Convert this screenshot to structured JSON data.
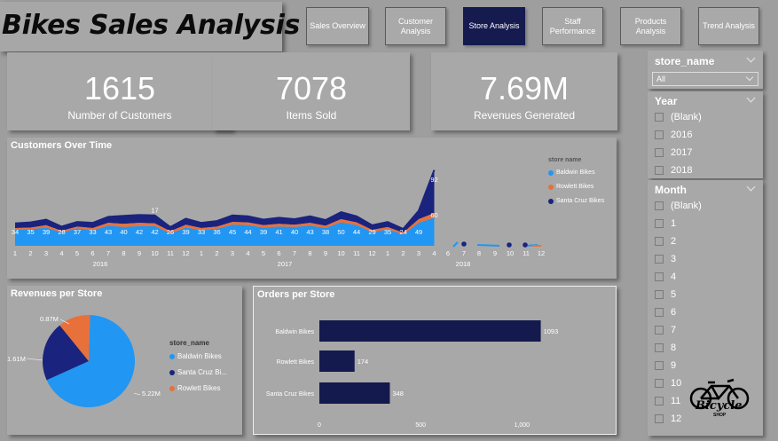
{
  "app": {
    "title": "Bikes Sales Analysis"
  },
  "nav": [
    {
      "label": "Sales Overview",
      "active": false
    },
    {
      "label": "Customer Analysis",
      "active": false
    },
    {
      "label": "Store Analysis",
      "active": true
    },
    {
      "label": "Staff Performance",
      "active": false
    },
    {
      "label": "Products Analysis",
      "active": false
    },
    {
      "label": "Trend Analysis",
      "active": false
    }
  ],
  "kpis": [
    {
      "value": "1615",
      "label": "Number of Customers"
    },
    {
      "value": "7078",
      "label": "Items Sold"
    },
    {
      "value": "7.69M",
      "label": "Revenues Generated"
    }
  ],
  "customers_chart": {
    "title": "Customers Over Time",
    "legend_title": "store name",
    "legend": [
      "Baldwin Bikes",
      "Rowlett Bikes",
      "Santa Cruz Bikes"
    ],
    "colors": [
      "#2196f3",
      "#e8703a",
      "#1a237e"
    ],
    "month_ticks": [
      "1",
      "2",
      "3",
      "4",
      "5",
      "6",
      "7",
      "8",
      "9",
      "10",
      "11",
      "12",
      "1",
      "2",
      "3",
      "4",
      "5",
      "6",
      "7",
      "8",
      "9",
      "10",
      "11",
      "12",
      "1",
      "2",
      "3",
      "4",
      "6",
      "7",
      "8",
      "9",
      "10",
      "11",
      "12"
    ],
    "year_ticks": [
      "2016",
      "2017",
      "2018"
    ]
  },
  "revenue_pie": {
    "title": "Revenues per Store",
    "legend_title": "store_name",
    "legend": [
      "Baldwin Bikes",
      "Santa Cruz Bi...",
      "Rowlett Bikes"
    ],
    "slice_labels": [
      "5.22M",
      "1.61M",
      "0.87M"
    ]
  },
  "orders_bar": {
    "title": "Orders per Store",
    "categories": [
      "Baldwin Bikes",
      "Rowlett Bikes",
      "Santa Cruz Bikes"
    ],
    "value_labels": [
      "1093",
      "174",
      "348"
    ],
    "axis_ticks": [
      "0",
      "500",
      "1,000"
    ]
  },
  "slicers": {
    "store": {
      "header": "store_name",
      "value": "All"
    },
    "year": {
      "header": "Year",
      "options": [
        "(Blank)",
        "2016",
        "2017",
        "2018"
      ]
    },
    "month": {
      "header": "Month",
      "options": [
        "(Blank)",
        "1",
        "2",
        "3",
        "4",
        "5",
        "6",
        "7",
        "8",
        "9",
        "10",
        "11",
        "12"
      ]
    }
  },
  "logo": {
    "text": "Bicycle",
    "subtext": "SHOP"
  },
  "chart_data": [
    {
      "type": "area",
      "title": "Customers Over Time",
      "xlabel": "",
      "ylabel": "",
      "x": [
        "2016-01",
        "2016-02",
        "2016-03",
        "2016-04",
        "2016-05",
        "2016-06",
        "2016-07",
        "2016-08",
        "2016-09",
        "2016-10",
        "2016-11",
        "2016-12",
        "2017-01",
        "2017-02",
        "2017-03",
        "2017-04",
        "2017-05",
        "2017-06",
        "2017-07",
        "2017-08",
        "2017-09",
        "2017-10",
        "2017-11",
        "2017-12",
        "2018-01",
        "2018-02",
        "2018-03",
        "2018-04"
      ],
      "series": [
        {
          "name": "Baldwin Bikes",
          "values": [
            34,
            35,
            39,
            28,
            37,
            33,
            43,
            40,
            42,
            42,
            26,
            39,
            33,
            36,
            45,
            44,
            39,
            41,
            40,
            43,
            38,
            50,
            44,
            29,
            35,
            24,
            49,
            60
          ]
        },
        {
          "name": "Rowlett Bikes",
          "values": [
            4,
            4,
            5,
            4,
            4,
            5,
            6,
            7,
            7,
            6,
            5,
            6,
            5,
            5,
            6,
            6,
            5,
            6,
            5,
            6,
            5,
            7,
            6,
            5,
            5,
            4,
            8,
            10
          ]
        },
        {
          "name": "Santa Cruz Bikes",
          "values": [
            10,
            11,
            12,
            9,
            10,
            11,
            13,
            17,
            17,
            17,
            9,
            13,
            11,
            12,
            14,
            13,
            12,
            13,
            12,
            14,
            12,
            15,
            13,
            10,
            11,
            8,
            18,
            92
          ]
        }
      ],
      "point_labels": [
        {
          "x": "2016-01",
          "label": "34"
        },
        {
          "x": "2016-02",
          "label": "35"
        },
        {
          "x": "2016-03",
          "label": "39"
        },
        {
          "x": "2016-04",
          "label": "28"
        },
        {
          "x": "2016-05",
          "label": "37"
        },
        {
          "x": "2016-06",
          "label": "33"
        },
        {
          "x": "2016-07",
          "label": "43"
        },
        {
          "x": "2016-08",
          "label": "40"
        },
        {
          "x": "2016-09",
          "label": "42"
        },
        {
          "x": "2016-10",
          "label": "42"
        },
        {
          "x": "2016-10",
          "label": "17"
        },
        {
          "x": "2016-11",
          "label": "26"
        },
        {
          "x": "2016-12",
          "label": "39"
        },
        {
          "x": "2017-01",
          "label": "33"
        },
        {
          "x": "2017-02",
          "label": "36"
        },
        {
          "x": "2017-03",
          "label": "45"
        },
        {
          "x": "2017-04",
          "label": "44"
        },
        {
          "x": "2017-05",
          "label": "39"
        },
        {
          "x": "2017-06",
          "label": "41"
        },
        {
          "x": "2017-07",
          "label": "40"
        },
        {
          "x": "2017-08",
          "label": "43"
        },
        {
          "x": "2017-09",
          "label": "38"
        },
        {
          "x": "2017-10",
          "label": "50"
        },
        {
          "x": "2017-11",
          "label": "44"
        },
        {
          "x": "2017-12",
          "label": "29"
        },
        {
          "x": "2018-01",
          "label": "35"
        },
        {
          "x": "2018-02",
          "label": "24"
        },
        {
          "x": "2018-03",
          "label": "49"
        },
        {
          "x": "2018-04",
          "label": "60"
        },
        {
          "x": "2018-04",
          "label": "92"
        }
      ],
      "legend_position": "right"
    },
    {
      "type": "pie",
      "title": "Revenues per Store",
      "categories": [
        "Baldwin Bikes",
        "Santa Cruz Bikes",
        "Rowlett Bikes"
      ],
      "values": [
        5.22,
        1.61,
        0.87
      ],
      "legend_position": "right"
    },
    {
      "type": "bar",
      "title": "Orders per Store",
      "categories": [
        "Baldwin Bikes",
        "Rowlett Bikes",
        "Santa Cruz Bikes"
      ],
      "values": [
        1093,
        174,
        348
      ],
      "xlim": [
        0,
        1200
      ],
      "orientation": "horizontal"
    }
  ]
}
